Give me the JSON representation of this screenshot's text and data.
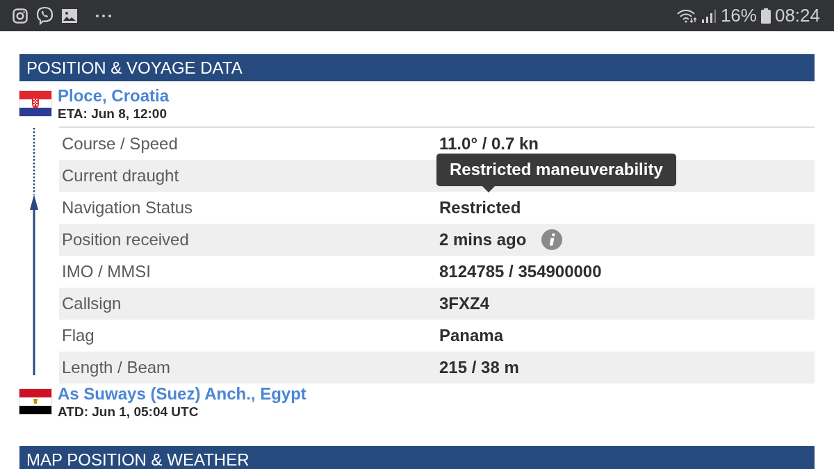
{
  "status_bar": {
    "battery": "16%",
    "time": "08:24"
  },
  "sections": [
    {
      "title": "POSITION & VOYAGE DATA"
    },
    {
      "title": "MAP POSITION & WEATHER"
    }
  ],
  "destination": {
    "kind": "croatia",
    "port": "Ploce, Croatia",
    "detail": "ETA: Jun 8, 12:00"
  },
  "rows": [
    {
      "label": "Course / Speed",
      "value": "11.0° / 0.7 kn",
      "info": false
    },
    {
      "label": "Current draught",
      "info": false
    },
    {
      "label": "Navigation Status",
      "value": "Restricted",
      "info": false,
      "tooltip": "Restricted maneuverability"
    },
    {
      "label": "Position received",
      "value": "2 mins ago",
      "info": true
    },
    {
      "label": "IMO / MMSI",
      "value": "8124785 / 354900000",
      "info": false
    },
    {
      "label": "Callsign",
      "value": "3FXZ4",
      "info": false
    },
    {
      "label": "Flag",
      "value": "Panama",
      "info": false
    },
    {
      "label": "Length / Beam",
      "value": "215 / 38 m",
      "info": false
    }
  ],
  "origin": {
    "kind": "egypt",
    "port": "As Suways (Suez) Anch., Egypt",
    "detail": "ATD: Jun 1, 05:04 UTC"
  }
}
